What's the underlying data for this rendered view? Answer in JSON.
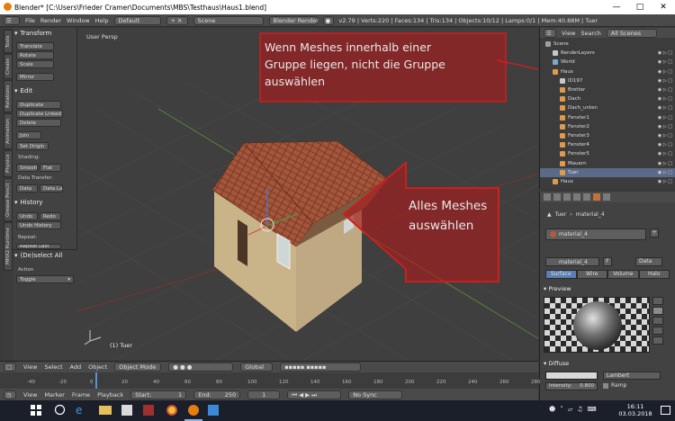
{
  "window": {
    "title": "Blender* [C:\\Users\\Frieder Cramer\\Documents\\MBS\\Testhaus\\Haus1.blend]",
    "min_icon": "minimize-icon",
    "max_icon": "maximize-icon",
    "close_icon": "close-icon"
  },
  "info_header": {
    "menus": [
      "File",
      "Render",
      "Window",
      "Help"
    ],
    "layout": "Default",
    "scene": "Scene",
    "engine": "Blender Render",
    "stats": "v2.79 | Verts:220 | Faces:134 | Tris:134 | Objects:10/12 | Lamps:0/1 | Mem:40.88M | Tuer"
  },
  "tool_tabs": [
    "Tools",
    "Create",
    "Relations",
    "Animation",
    "Physics",
    "Grease Pencil",
    "MHX2 Runtime"
  ],
  "tool_shelf": {
    "transform_title": "Transform",
    "translate": "Translate",
    "rotate": "Rotate",
    "scale": "Scale",
    "mirror": "Mirror",
    "edit_title": "Edit",
    "duplicate": "Duplicate",
    "duplicate_linked": "Duplicate Linked",
    "delete": "Delete",
    "join": "Join",
    "set_origin": "Set Origin",
    "shading_label": "Shading:",
    "smooth": "Smooth",
    "flat": "Flat",
    "data_transfer_label": "Data Transfer:",
    "data": "Data",
    "data_la": "Data La",
    "history_title": "History",
    "undo": "Undo",
    "redo": "Redo",
    "undo_history": "Undo History",
    "repeat_label": "Repeat:",
    "repeat_last": "Repeat Last",
    "operator_title": "(De)select All",
    "action_label": "Action",
    "action_value": "Toggle"
  },
  "viewport": {
    "view_label": "User Persp",
    "object_label": "(1) Tuer"
  },
  "annotations": {
    "top": "Wenn Meshes innerhalb einer Gruppe liegen, nicht die Gruppe auswählen",
    "top_lines": [
      "Wenn Meshes innerhalb einer",
      "Gruppe liegen, nicht die Gruppe",
      "auswählen"
    ],
    "arrow_lines": [
      "Alles Meshes",
      "auswählen"
    ],
    "color": "#b41c1c"
  },
  "outliner": {
    "view": "View",
    "search": "Search",
    "scenes": "All Scenes",
    "items": [
      {
        "name": "Scene",
        "indent": 0,
        "color": "#a0a0a0"
      },
      {
        "name": "RenderLayers",
        "indent": 1,
        "color": "#c8c8c8"
      },
      {
        "name": "World",
        "indent": 1,
        "color": "#7aa7d4"
      },
      {
        "name": "Haus",
        "indent": 1,
        "color": "#e09a4a"
      },
      {
        "name": "ID197",
        "indent": 2,
        "color": "#c8c8c8"
      },
      {
        "name": "Bretter",
        "indent": 2,
        "color": "#e09a4a"
      },
      {
        "name": "Dach",
        "indent": 2,
        "color": "#e09a4a"
      },
      {
        "name": "Dach_unten",
        "indent": 2,
        "color": "#e09a4a"
      },
      {
        "name": "Fenster1",
        "indent": 2,
        "color": "#e09a4a"
      },
      {
        "name": "Fenster2",
        "indent": 2,
        "color": "#e09a4a"
      },
      {
        "name": "Fenster3",
        "indent": 2,
        "color": "#e09a4a"
      },
      {
        "name": "Fenster4",
        "indent": 2,
        "color": "#e09a4a"
      },
      {
        "name": "Fenster5",
        "indent": 2,
        "color": "#e09a4a"
      },
      {
        "name": "Mauern",
        "indent": 2,
        "color": "#e09a4a"
      },
      {
        "name": "Tuer",
        "indent": 2,
        "color": "#e09a4a"
      },
      {
        "name": "Haus",
        "indent": 1,
        "color": "#e09a4a"
      }
    ]
  },
  "properties": {
    "breadcrumb_obj": "Tuer",
    "breadcrumb_mat": "material_4",
    "slot": "material_4",
    "datablock": "material_4",
    "f_label": "F",
    "data_btn": "Data",
    "tabs": [
      "Surface",
      "Wire",
      "Volume",
      "Halo"
    ],
    "preview_title": "Preview",
    "diffuse_title": "Diffuse",
    "shader": "Lambert",
    "intensity_label": "Intensity:",
    "intensity_value": "0.800",
    "ramp": "Ramp"
  },
  "timeline": {
    "menus": [
      "View",
      "Select",
      "Add",
      "Object"
    ],
    "mode": "Object Mode",
    "orientation": "Global",
    "ticks": [
      "-40",
      "-20",
      "0",
      "20",
      "40",
      "60",
      "80",
      "100",
      "120",
      "140",
      "160",
      "180",
      "200",
      "220",
      "240",
      "260",
      "280"
    ],
    "menus2": [
      "View",
      "Marker",
      "Frame",
      "Playback"
    ],
    "start_label": "Start:",
    "start": "1",
    "end_label": "End:",
    "end": "250",
    "current": "1",
    "sync": "No Sync"
  },
  "taskbar": {
    "time": "16:11",
    "date": "03.03.2018"
  }
}
